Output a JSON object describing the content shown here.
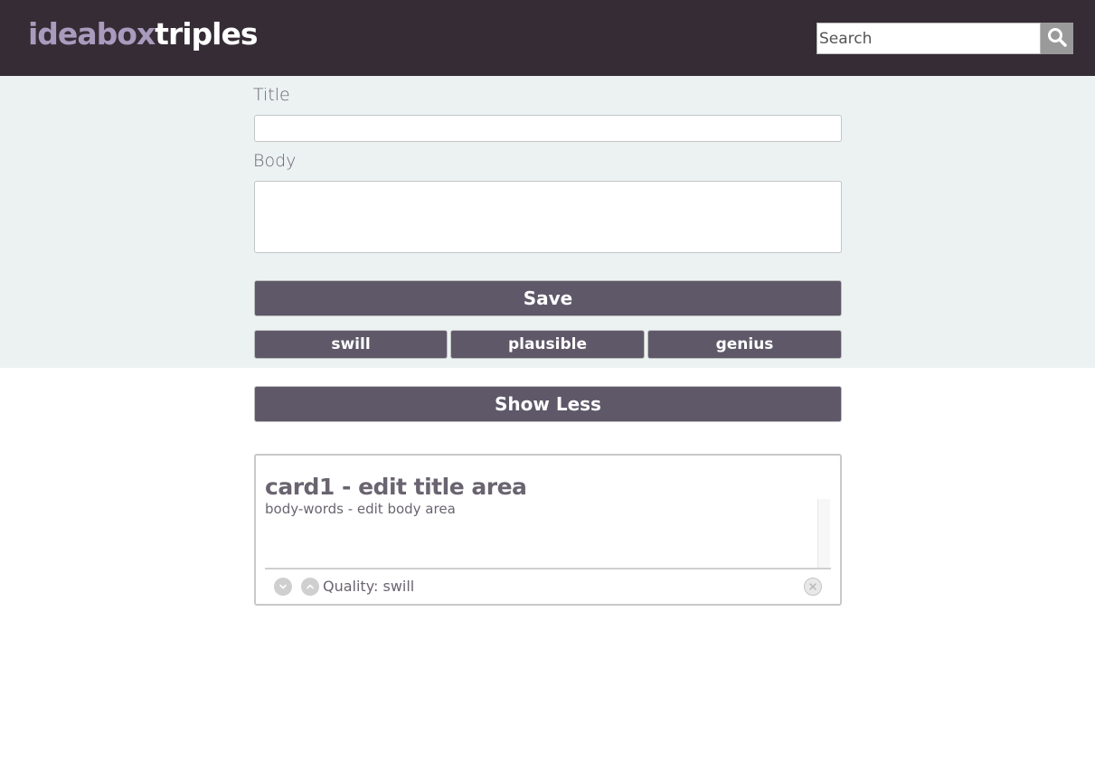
{
  "header": {
    "logo_part1": "ideabox",
    "logo_part2": "triples",
    "search_placeholder": "Search",
    "search_icon": "search-icon"
  },
  "form": {
    "title_label": "Title",
    "title_value": "",
    "body_label": "Body",
    "body_value": "",
    "save_label": "Save",
    "quality_buttons": [
      "swill",
      "plausible",
      "genius"
    ]
  },
  "show_less_label": "Show Less",
  "cards": [
    {
      "title": "card1 - edit title area",
      "body": "body-words - edit body area",
      "quality_text": "Quality: swill",
      "icons": [
        "chevron-down-icon",
        "chevron-up-icon",
        "close-icon"
      ]
    }
  ],
  "colors": {
    "header_bg": "#352c35",
    "logo_accent": "#a99bbd",
    "button_bg": "#5e5869",
    "form_bg": "#ecf2f2",
    "text": "#6a6470"
  }
}
